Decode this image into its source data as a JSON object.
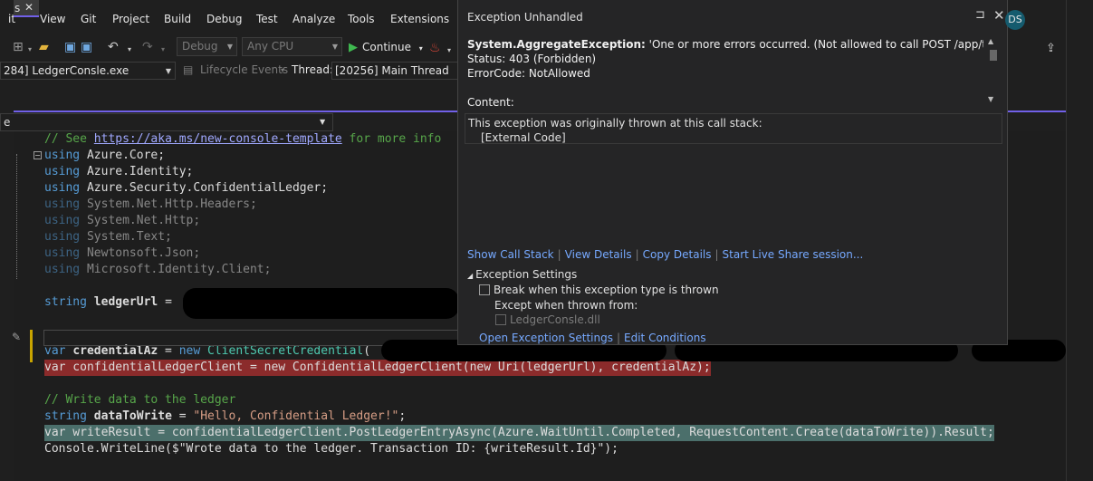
{
  "menu": [
    "it",
    "View",
    "Git",
    "Project",
    "Build",
    "Debug",
    "Test",
    "Analyze",
    "Tools",
    "Extensions"
  ],
  "toolbar": {
    "config": "Debug",
    "platform": "Any CPU",
    "continue_label": "Continue"
  },
  "debug_location": {
    "process": "284] LedgerConsle.exe",
    "lifecycle": "Lifecycle Events",
    "thread_label": "Thread:",
    "thread": "[20256] Main Thread"
  },
  "tab": {
    "label": "s",
    "close": "✕"
  },
  "navbar": {
    "label": "e"
  },
  "code": {
    "line1": {
      "comment_prefix": "// See ",
      "link": "https://aka.ms/new-console-template",
      "comment_suffix": " for more info"
    },
    "usings": [
      {
        "kw": "using",
        "ns": "Azure.Core;"
      },
      {
        "kw": "using",
        "ns": "Azure.Identity;"
      },
      {
        "kw": "using",
        "ns": "Azure.Security.ConfidentialLedger;"
      },
      {
        "kw": "using",
        "ns": "System.Net.Http.Headers;"
      },
      {
        "kw": "using",
        "ns": "System.Net.Http;"
      },
      {
        "kw": "using",
        "ns": "System.Text;"
      },
      {
        "kw": "using",
        "ns": "Newtonsoft.Json;"
      },
      {
        "kw": "using",
        "ns": "Microsoft.Identity.Client;"
      }
    ],
    "ledger_url": {
      "kw": "string",
      "name": "ledgerUrl",
      "op": " = "
    },
    "credential": {
      "kw": "var",
      "name": "credentialAz",
      "op": " = ",
      "new": "new",
      "type": "ClientSecretCredential",
      "paren": "("
    },
    "ledger_client": "var confidentialLedgerClient = new ConfidentialLedgerClient(new Uri(ledgerUrl), credentialAz);",
    "comment_write": "// Write data to the ledger",
    "data_to_write": {
      "kw": "string",
      "name": "dataToWrite",
      "op": " = ",
      "value": "\"Hello, Confidential Ledger!\"",
      "end": ";"
    },
    "write_result": "var writeResult = confidentialLedgerClient.PostLedgerEntryAsync(Azure.WaitUntil.Completed, RequestContent.Create(dataToWrite)).Result;",
    "console_partial": "Console.WriteLine($\"Wrote data to the ledger. Transaction ID: {writeResult.Id}\");"
  },
  "exception": {
    "title": "Exception Unhandled",
    "type": "System.AggregateException:",
    "message": " 'One or more errors occurred. (Not allowed to call POST /app/transactions",
    "status": "Status: 403 (Forbidden)",
    "error_code": "ErrorCode: NotAllowed",
    "content_label": "Content:",
    "stack_header": "This exception was originally thrown at this call stack:",
    "stack_frame": "[External Code]",
    "links": [
      "Show Call Stack",
      "View Details",
      "Copy Details",
      "Start Live Share session..."
    ],
    "settings_header": "Exception Settings",
    "break_label": "Break when this exception type is thrown",
    "except_label": "Except when thrown from:",
    "module": "LedgerConsle.dll",
    "bottom_links": [
      "Open Exception Settings",
      "Edit Conditions"
    ]
  },
  "user": {
    "initials": "DS"
  }
}
